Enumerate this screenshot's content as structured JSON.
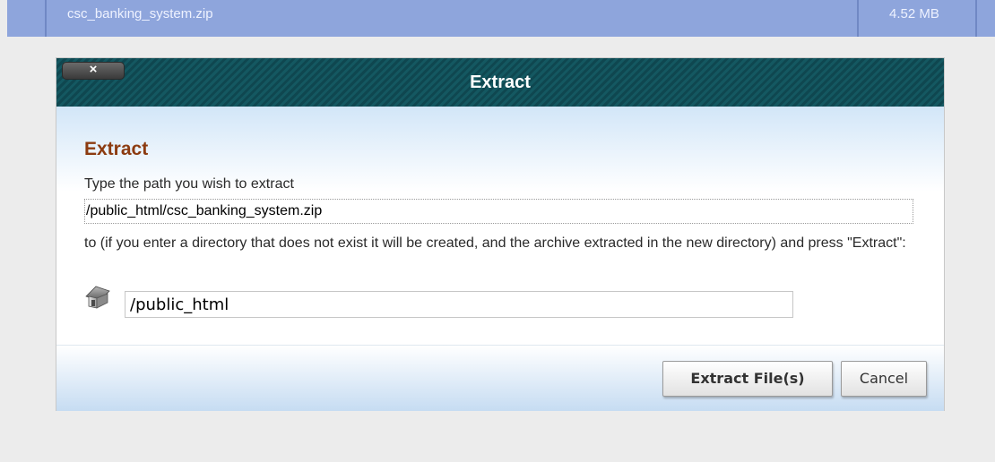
{
  "file_row": {
    "name": "csc_banking_system.zip",
    "size": "4.52 MB"
  },
  "dialog": {
    "title": "Extract",
    "close_label": "×",
    "heading": "Extract",
    "prompt": "Type the path you wish to extract",
    "source_path": "/public_html/csc_banking_system.zip",
    "instruction": "to (if you enter a directory that does not exist it will be created, and the archive extracted in the new directory) and press \"Extract\":",
    "destination_value": "/public_html",
    "extract_button": "Extract File(s)",
    "cancel_button": "Cancel"
  },
  "colors": {
    "header": "#0f4750",
    "heading": "#8c3b10",
    "file_row": "#8ea5dc"
  },
  "icons": {
    "destination": "home-icon",
    "close": "close-icon"
  }
}
